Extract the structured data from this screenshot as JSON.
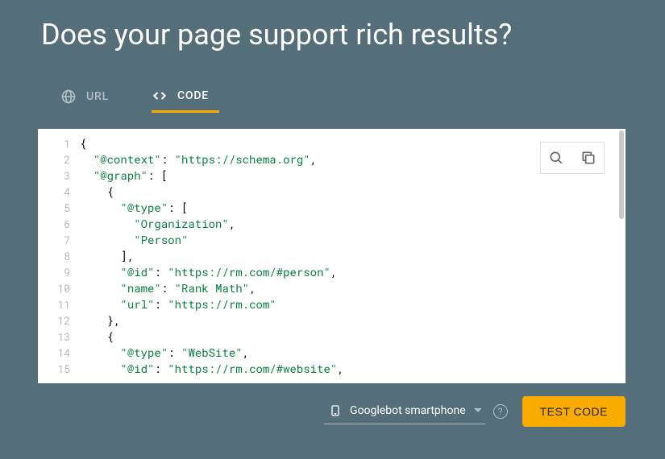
{
  "title": "Does your page support rich results?",
  "tabs": {
    "url": "URL",
    "code": "CODE",
    "active": "code"
  },
  "codeLines": [
    [
      {
        "t": "pun",
        "v": "{"
      }
    ],
    [
      {
        "t": "pad",
        "v": "  "
      },
      {
        "t": "str",
        "v": "\"@context\""
      },
      {
        "t": "pun",
        "v": ": "
      },
      {
        "t": "str",
        "v": "\"https://schema.org\""
      },
      {
        "t": "pun",
        "v": ","
      }
    ],
    [
      {
        "t": "pad",
        "v": "  "
      },
      {
        "t": "str",
        "v": "\"@graph\""
      },
      {
        "t": "pun",
        "v": ": ["
      }
    ],
    [
      {
        "t": "pad",
        "v": "    "
      },
      {
        "t": "pun",
        "v": "{"
      }
    ],
    [
      {
        "t": "pad",
        "v": "      "
      },
      {
        "t": "str",
        "v": "\"@type\""
      },
      {
        "t": "pun",
        "v": ": ["
      }
    ],
    [
      {
        "t": "pad",
        "v": "        "
      },
      {
        "t": "str",
        "v": "\"Organization\""
      },
      {
        "t": "pun",
        "v": ","
      }
    ],
    [
      {
        "t": "pad",
        "v": "        "
      },
      {
        "t": "str",
        "v": "\"Person\""
      }
    ],
    [
      {
        "t": "pad",
        "v": "      "
      },
      {
        "t": "pun",
        "v": "],"
      }
    ],
    [
      {
        "t": "pad",
        "v": "      "
      },
      {
        "t": "str",
        "v": "\"@id\""
      },
      {
        "t": "pun",
        "v": ": "
      },
      {
        "t": "str",
        "v": "\"https://rm.com/#person\""
      },
      {
        "t": "pun",
        "v": ","
      }
    ],
    [
      {
        "t": "pad",
        "v": "      "
      },
      {
        "t": "str",
        "v": "\"name\""
      },
      {
        "t": "pun",
        "v": ": "
      },
      {
        "t": "str",
        "v": "\"Rank Math\""
      },
      {
        "t": "pun",
        "v": ","
      }
    ],
    [
      {
        "t": "pad",
        "v": "      "
      },
      {
        "t": "str",
        "v": "\"url\""
      },
      {
        "t": "pun",
        "v": ": "
      },
      {
        "t": "str",
        "v": "\"https://rm.com\""
      }
    ],
    [
      {
        "t": "pad",
        "v": "    "
      },
      {
        "t": "pun",
        "v": "},"
      }
    ],
    [
      {
        "t": "pad",
        "v": "    "
      },
      {
        "t": "pun",
        "v": "{"
      }
    ],
    [
      {
        "t": "pad",
        "v": "      "
      },
      {
        "t": "str",
        "v": "\"@type\""
      },
      {
        "t": "pun",
        "v": ": "
      },
      {
        "t": "str",
        "v": "\"WebSite\""
      },
      {
        "t": "pun",
        "v": ","
      }
    ],
    [
      {
        "t": "pad",
        "v": "      "
      },
      {
        "t": "str",
        "v": "\"@id\""
      },
      {
        "t": "pun",
        "v": ": "
      },
      {
        "t": "str",
        "v": "\"https://rm.com/#website\""
      },
      {
        "t": "pun",
        "v": ","
      }
    ]
  ],
  "agentSelector": {
    "label": "Googlebot smartphone"
  },
  "testButton": "TEST CODE"
}
